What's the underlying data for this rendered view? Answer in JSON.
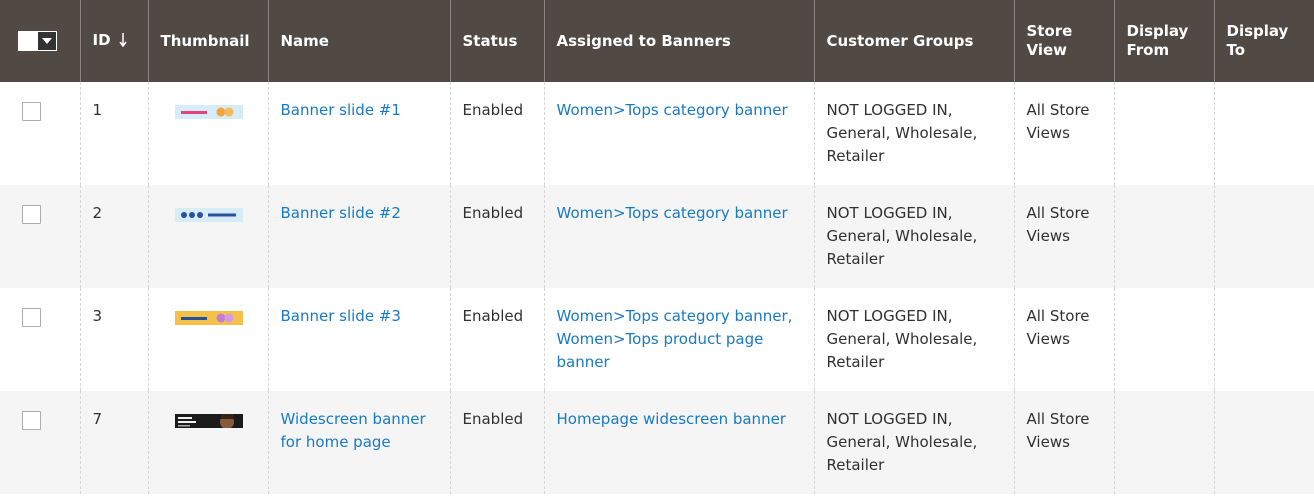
{
  "columns": {
    "id": "ID",
    "thumbnail": "Thumbnail",
    "name": "Name",
    "status": "Status",
    "assigned": "Assigned to Banners",
    "groups": "Customer Groups",
    "store_view": "Store View",
    "display_from": "Display From",
    "display_to": "Display To"
  },
  "rows": [
    {
      "id": "1",
      "thumbnail_icon": "banner-slide-thumbnail-icon",
      "name": "Banner slide #1",
      "status": "Enabled",
      "assigned": "Women>Tops category banner",
      "groups": "NOT LOGGED IN, General, Wholesale, Retailer",
      "store_view": "All Store Views",
      "display_from": "",
      "display_to": ""
    },
    {
      "id": "2",
      "thumbnail_icon": "banner-slide-thumbnail-icon",
      "name": "Banner slide #2",
      "status": "Enabled",
      "assigned": "Women>Tops category banner",
      "groups": "NOT LOGGED IN, General, Wholesale, Retailer",
      "store_view": "All Store Views",
      "display_from": "",
      "display_to": ""
    },
    {
      "id": "3",
      "thumbnail_icon": "banner-slide-thumbnail-icon",
      "name": "Banner slide #3",
      "status": "Enabled",
      "assigned": "Women>Tops category banner, Women>Tops product page banner",
      "groups": "NOT LOGGED IN, General, Wholesale, Retailer",
      "store_view": "All Store Views",
      "display_from": "",
      "display_to": ""
    },
    {
      "id": "7",
      "thumbnail_icon": "widescreen-banner-thumbnail-icon",
      "name": "Widescreen banner for home page",
      "status": "Enabled",
      "assigned": "Homepage widescreen banner",
      "groups": "NOT LOGGED IN, General, Wholesale, Retailer",
      "store_view": "All Store Views",
      "display_from": "",
      "display_to": ""
    }
  ],
  "colors": {
    "header_bg": "#514943",
    "header_text": "#ffffff",
    "link": "#1979c3",
    "alt_row_bg": "#f5f5f5"
  }
}
